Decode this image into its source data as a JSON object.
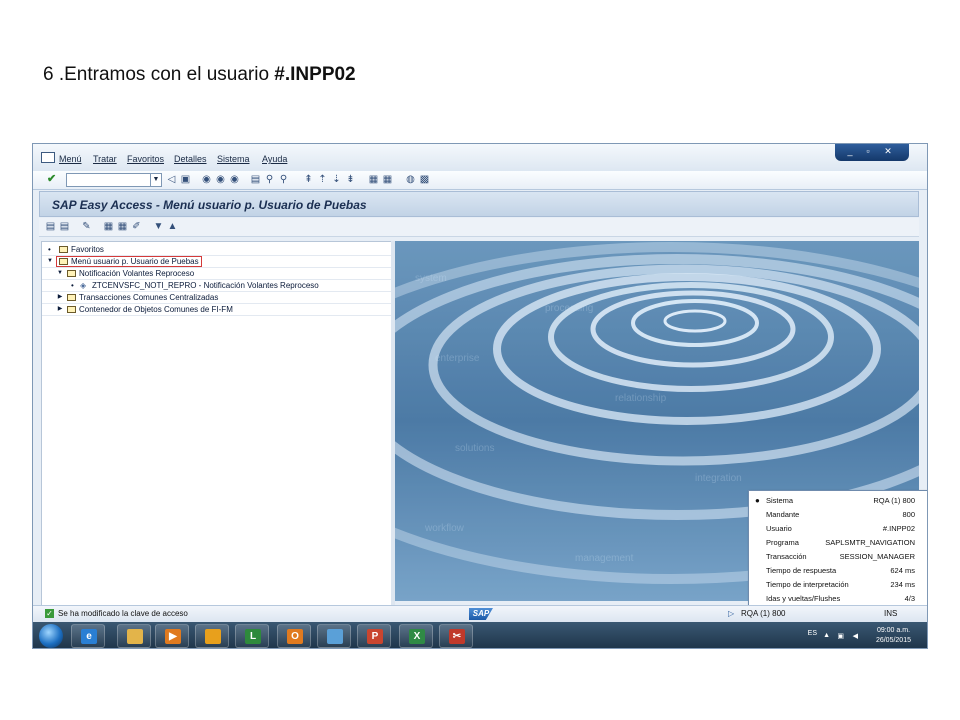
{
  "caption": {
    "prefix": "6 .Entramos con el usuario ",
    "user": "#.INPP02"
  },
  "menu": [
    "Menú",
    "Tratar",
    "Favoritos",
    "Detalles",
    "Sistema",
    "Ayuda"
  ],
  "title": "SAP Easy Access  -  Menú usuario p. Usuario de Puebas",
  "tree": [
    {
      "label": "Favoritos"
    },
    {
      "label": "Menú usuario p. Usuario de Puebas"
    },
    {
      "label": "Notificación Volantes Reproceso"
    },
    {
      "label": "ZTCENVSFC_NOTI_REPRO - Notificación Volantes Reproceso"
    },
    {
      "label": "Transacciones Comunes Centralizadas"
    },
    {
      "label": "Contenedor de Objetos Comunes de FI-FM"
    }
  ],
  "popup": [
    {
      "k": "Sistema",
      "v": "RQA (1) 800"
    },
    {
      "k": "Mandante",
      "v": "800"
    },
    {
      "k": "Usuario",
      "v": "#.INPP02"
    },
    {
      "k": "Programa",
      "v": "SAPLSMTR_NAVIGATION"
    },
    {
      "k": "Transacción",
      "v": "SESSION_MANAGER"
    },
    {
      "k": "Tiempo de respuesta",
      "v": "624 ms"
    },
    {
      "k": "Tiempo de interpretación",
      "v": "234 ms"
    },
    {
      "k": "Idas y vueltas/Flushes",
      "v": "4/3"
    }
  ],
  "status": {
    "message": "Se ha modificado la clave de acceso",
    "logo": "SAP",
    "system": "RQA (1) 800",
    "mode": "INS"
  },
  "tray": {
    "lang": "ES",
    "time": "09:00 a.m.",
    "date": "26/05/2015"
  },
  "taskbar_apps": [
    {
      "name": "internet-explorer",
      "color": "#2a7fd4"
    },
    {
      "name": "file-explorer",
      "color": "#e3b44a"
    },
    {
      "name": "media-player",
      "color": "#e07a1f"
    },
    {
      "name": "sap-logon",
      "color": "#e8a01c"
    },
    {
      "name": "lync",
      "color": "#2e8a3c"
    },
    {
      "name": "outlook",
      "color": "#e07a1f"
    },
    {
      "name": "notepad",
      "color": "#5aa0d8"
    },
    {
      "name": "powerpoint",
      "color": "#c9452f"
    },
    {
      "name": "excel",
      "color": "#2f8a45"
    },
    {
      "name": "snipping-tool",
      "color": "#c0392b"
    }
  ]
}
